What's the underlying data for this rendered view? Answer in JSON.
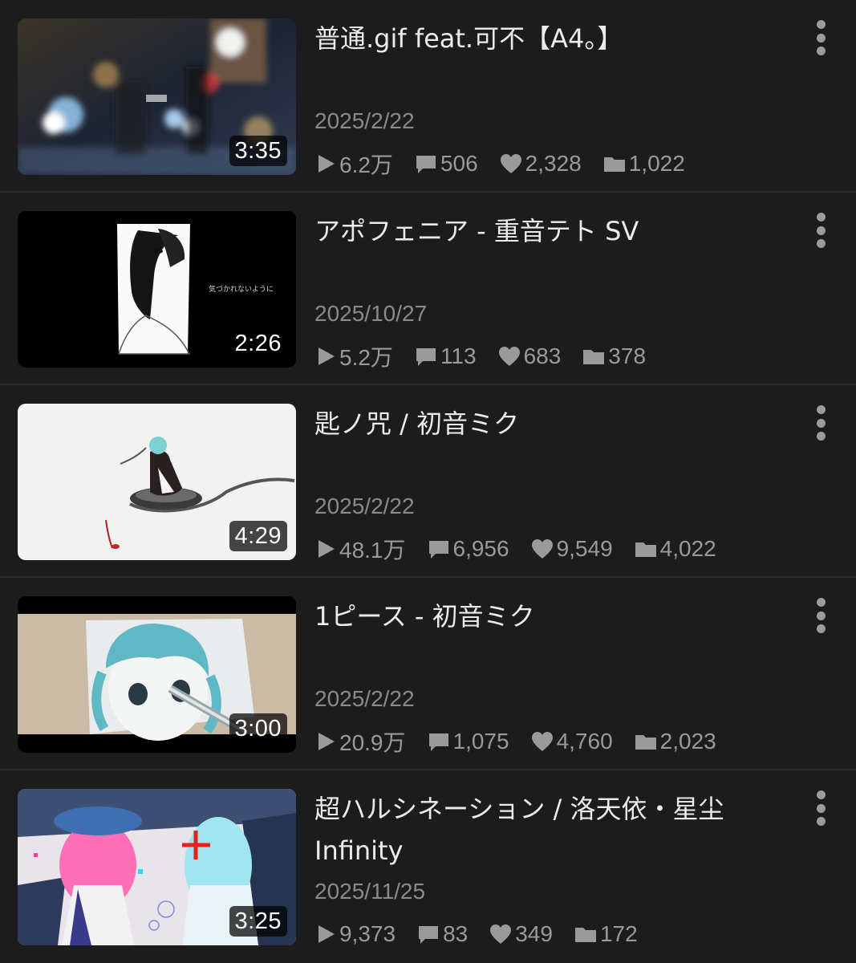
{
  "videos": [
    {
      "title": "普通.gif feat.可不【A4。】",
      "duration": "3:35",
      "date": "2025/2/22",
      "views": "6.2万",
      "comments": "506",
      "likes": "2,328",
      "mylists": "1,022"
    },
    {
      "title": "アポフェニア - 重音テト SV",
      "duration": "2:26",
      "date": "2025/10/27",
      "views": "5.2万",
      "comments": "113",
      "likes": "683",
      "mylists": "378",
      "thumb_caption": "気づかれないように"
    },
    {
      "title": "匙ノ咒 / 初音ミク",
      "duration": "4:29",
      "date": "2025/2/22",
      "views": "48.1万",
      "comments": "6,956",
      "likes": "9,549",
      "mylists": "4,022"
    },
    {
      "title": "1ピース - 初音ミク",
      "duration": "3:00",
      "date": "2025/2/22",
      "views": "20.9万",
      "comments": "1,075",
      "likes": "4,760",
      "mylists": "2,023"
    },
    {
      "title": "超ハルシネーション / 洛天依・星尘 Infinity",
      "duration": "3:25",
      "date": "2025/11/25",
      "views": "9,373",
      "comments": "83",
      "likes": "349",
      "mylists": "172"
    }
  ],
  "icons": {
    "views": "play-icon",
    "comments": "comment-icon",
    "likes": "heart-icon",
    "mylists": "folder-icon",
    "menu": "more-vertical-icon"
  },
  "colors": {
    "background": "#1c1c1c",
    "title": "#ebebeb",
    "meta": "#8a8a8a",
    "divider": "#2e2e2e"
  }
}
